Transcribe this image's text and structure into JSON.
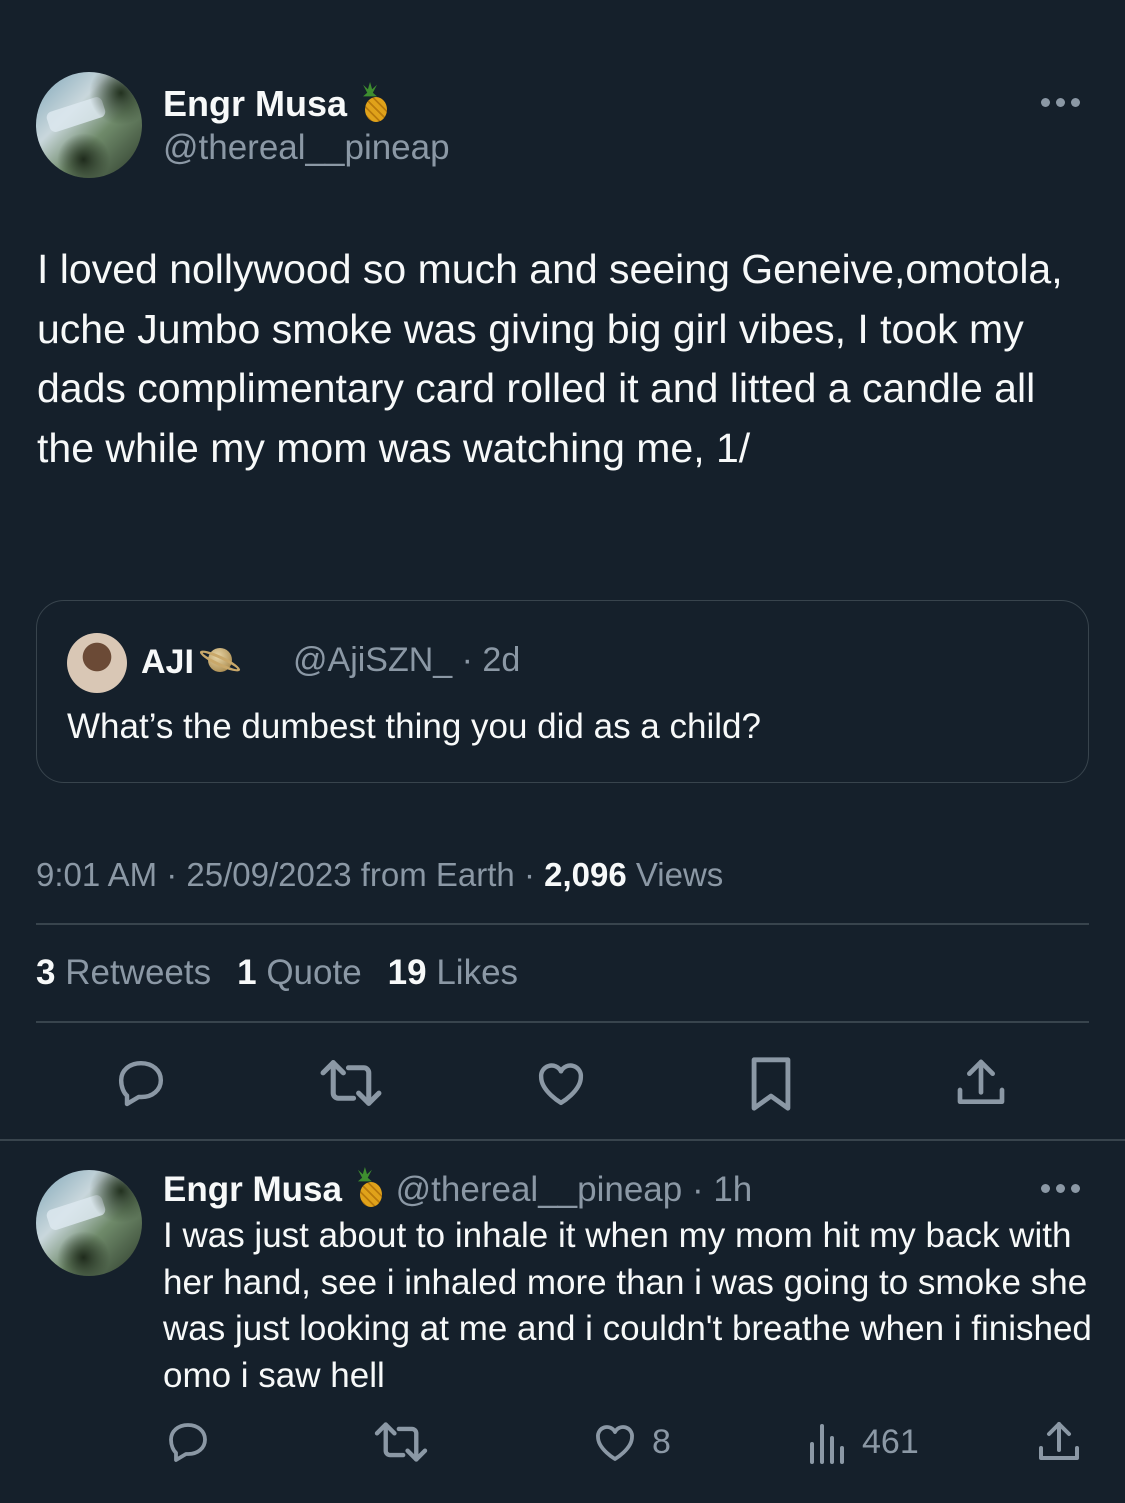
{
  "tweet": {
    "author_name": "Engr Musa",
    "author_handle": "@thereal__pineap",
    "badge_icon": "pineapple-emoji",
    "text": "I loved nollywood so much and seeing Geneive,omotola, uche Jumbo smoke was giving big girl vibes, I took my dads complimentary card rolled it and litted a candle all the while my mom was watching me, 1/",
    "quoted": {
      "author_name": "AJI",
      "badge_icon": "saturn-emoji",
      "handle_time": "@AjiSZN_ · 2d",
      "text": "What’s the dumbest thing you did as a child?"
    },
    "meta": {
      "timestamp": "9:01 AM · 25/09/2023 from Earth · ",
      "views_count": "2,096",
      "views_label": " Views"
    },
    "stats": {
      "retweets_count": "3",
      "retweets_label": "Retweets",
      "quotes_count": "1",
      "quotes_label": "Quote",
      "likes_count": "19",
      "likes_label": "Likes"
    },
    "actions": [
      "reply-icon",
      "retweet-icon",
      "like-icon",
      "bookmark-icon",
      "share-icon"
    ]
  },
  "reply": {
    "author_name": "Engr Musa",
    "badge_icon": "pineapple-emoji",
    "handle_time": "@thereal__pineap · 1h",
    "text": "I was just about to inhale it when my mom hit my back with her hand, see i inhaled more than i was going to smoke she was just looking at me and i couldn't breathe when i finished omo i saw hell",
    "likes": "8",
    "views": "461"
  },
  "colors": {
    "background": "#15202b",
    "text": "#f7f9f9",
    "secondary": "#8b98a5",
    "border": "#38444d"
  }
}
